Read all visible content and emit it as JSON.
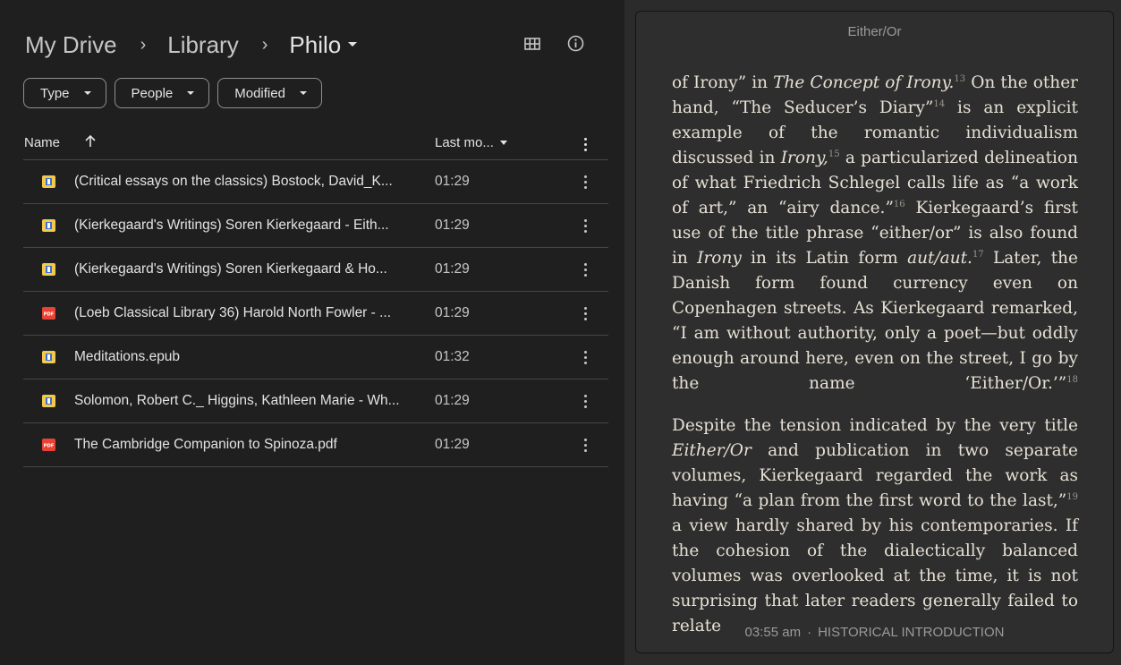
{
  "drive": {
    "breadcrumb": [
      "My Drive",
      "Library",
      "Philo"
    ],
    "breadcrumb_sep": "›",
    "filters": [
      "Type",
      "People",
      "Modified"
    ],
    "columns": {
      "name": "Name",
      "modified": "Last mo..."
    },
    "files": [
      {
        "name": "(Critical essays on the classics) Bostock, David_K...",
        "time": "01:29",
        "kind": "book-icon"
      },
      {
        "name": "(Kierkegaard's Writings) Soren Kierkegaard - Eith...",
        "time": "01:29",
        "kind": "book-icon"
      },
      {
        "name": "(Kierkegaard's Writings) Soren Kierkegaard & Ho...",
        "time": "01:29",
        "kind": "book-icon"
      },
      {
        "name": "(Loeb Classical Library 36) Harold North Fowler - ...",
        "time": "01:29",
        "kind": "pdf-icon"
      },
      {
        "name": "Meditations.epub",
        "time": "01:32",
        "kind": "book-icon"
      },
      {
        "name": "Solomon, Robert C._ Higgins, Kathleen Marie - Wh...",
        "time": "01:29",
        "kind": "book-icon"
      },
      {
        "name": "The Cambridge Companion to Spinoza.pdf",
        "time": "01:29",
        "kind": "pdf-icon"
      }
    ],
    "pdf_badge": "PDF",
    "colors": {
      "background": "#1f1f1f",
      "pdf": "#e94235",
      "book": "#f2c94c"
    }
  },
  "reader": {
    "title": "Either/Or",
    "footer_time": "03:55 am",
    "footer_dot": "·",
    "footer_section": "HISTORICAL INTRODUCTION",
    "p1": {
      "t1": "of Irony” in ",
      "i1": "The Concept of Irony.",
      "n1": "13",
      "t2": " On the other hand, “The Seducer’s Diary”",
      "n2": "14",
      "t3": " is an explicit example of the romantic individualism discussed in ",
      "i2": "Irony,",
      "n3": "15",
      "t4": " a particularized delineation of what Friedrich Schlegel calls life as “a work of art,” an “airy dance.”",
      "n4": "16",
      "t5": " Kierkegaard’s first use of the title phrase “either/or” is also found in ",
      "i3": "Irony",
      "t6": " in its Latin form ",
      "i4": "aut/aut.",
      "n5": "17",
      "t7": " Later, the Danish form found currency even on Copenhagen streets. As Kierkegaard remarked, “I am without authority, only a poet—but oddly enough around here, even on the street, I go by the name ‘Either/Or.’”",
      "n6": "18"
    },
    "p2": {
      "t1": "Despite the tension indicated by the very title ",
      "i1": "Either/Or",
      "t2": " and publication in two separate volumes, Kierkegaard regarded the work as having “a plan from the first word to the last,”",
      "n1": "19",
      "t3": " a view hardly shared by his contemporaries. If the cohesion of the dialectically balanced volumes was overlooked at the time, it is not surprising that later readers generally failed to relate"
    }
  }
}
